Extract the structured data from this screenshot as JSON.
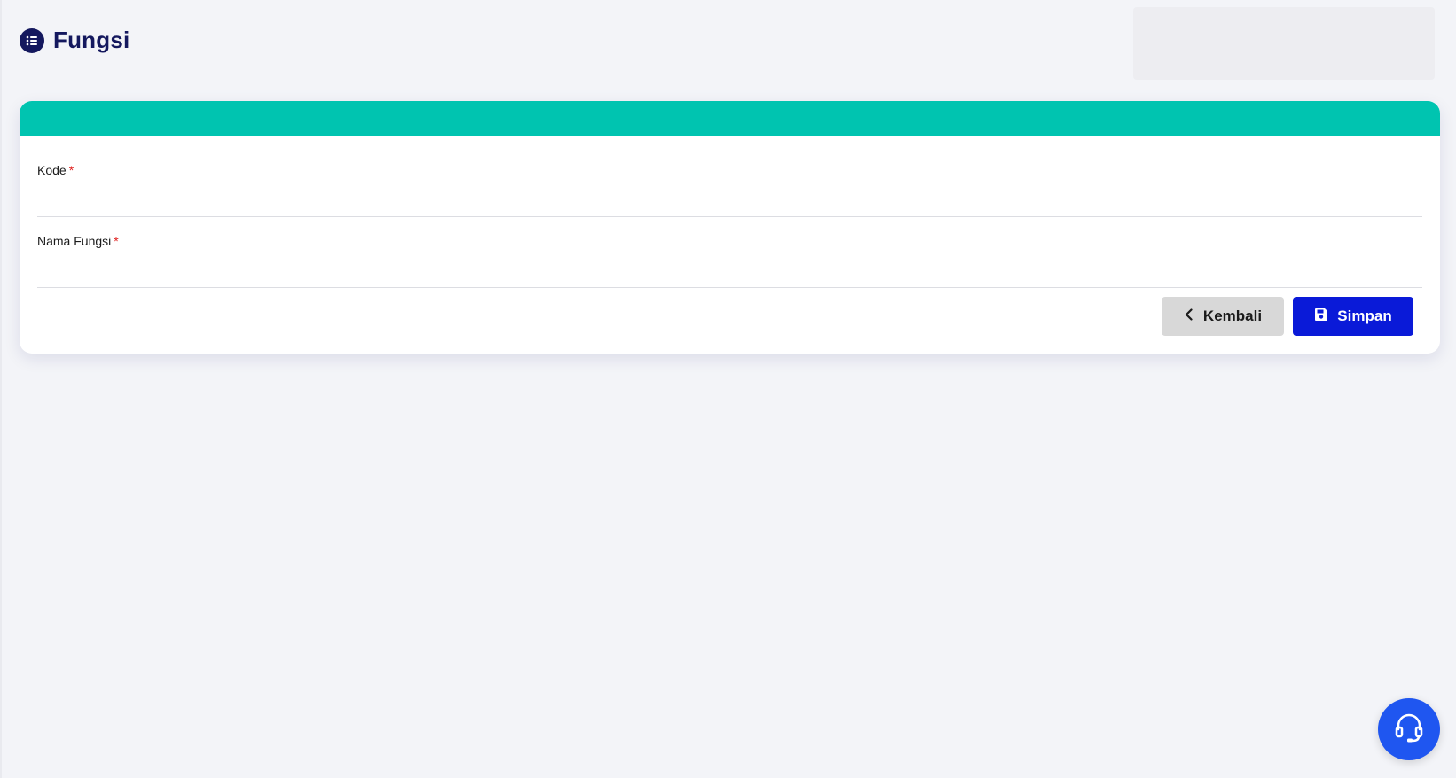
{
  "header": {
    "title": "Fungsi",
    "icon": "list-icon"
  },
  "form": {
    "header_color": "#00c4b0",
    "fields": [
      {
        "label": "Kode",
        "required_mark": "*",
        "value": ""
      },
      {
        "label": "Nama Fungsi",
        "required_mark": "*",
        "value": ""
      }
    ]
  },
  "actions": {
    "back_label": "Kembali",
    "back_icon": "chevron-left-icon",
    "save_label": "Simpan",
    "save_icon": "floppy-disk-icon"
  },
  "support": {
    "icon": "headset-icon",
    "color": "#1f56f0"
  },
  "colors": {
    "brand_dark": "#14185e",
    "primary": "#0a1ad8",
    "accent": "#00c4b0",
    "required": "#e0211f"
  }
}
